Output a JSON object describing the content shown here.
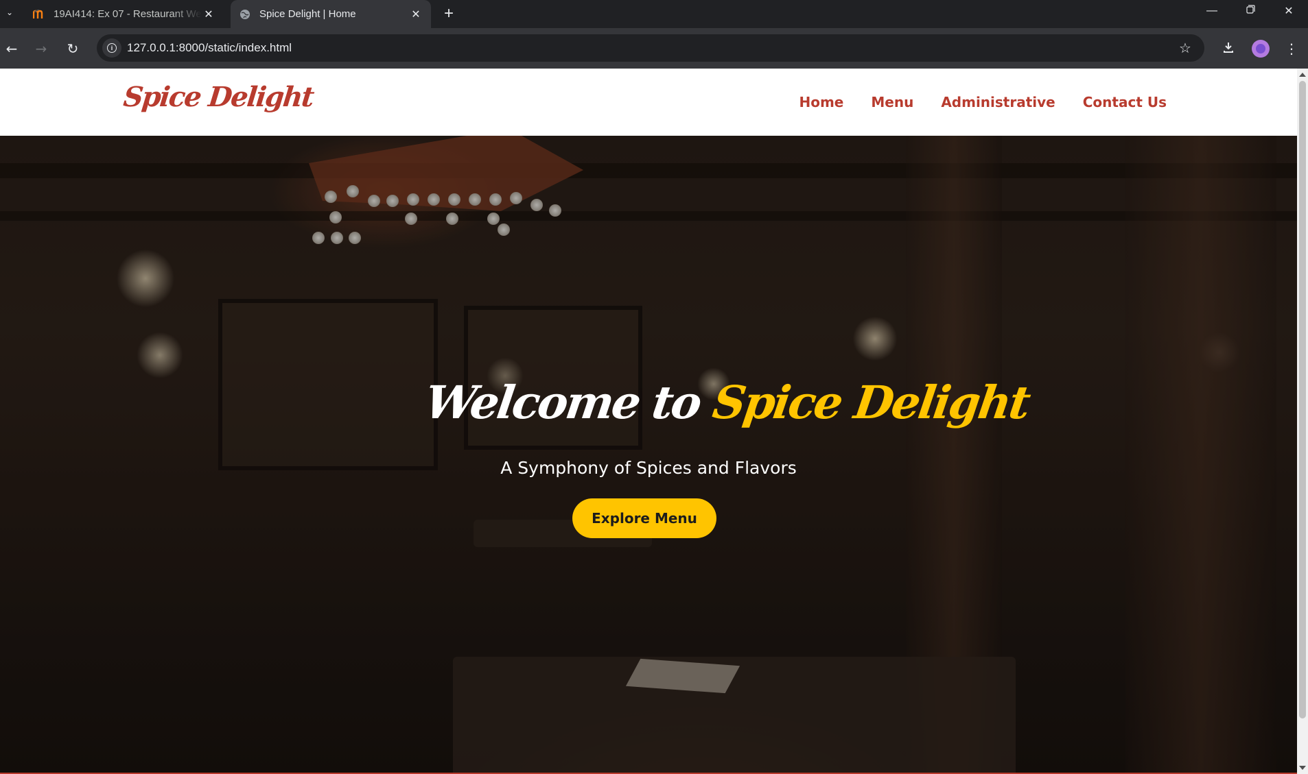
{
  "browser": {
    "tabs": [
      {
        "title": "19AI414: Ex 07 - Restaurant We",
        "favicon": "moodle-m-icon",
        "active": false
      },
      {
        "title": "Spice Delight | Home",
        "favicon": "globe-icon",
        "active": true
      }
    ],
    "url": "127.0.0.1:8000/static/index.html",
    "icons": {
      "tab_search": "chevron-down-icon",
      "new_tab": "plus-icon",
      "back": "arrow-left-icon",
      "forward": "arrow-right-icon",
      "reload": "reload-icon",
      "site_info": "info-icon",
      "bookmark": "star-icon",
      "downloads": "download-icon",
      "profile": "avatar",
      "menu": "kebab-menu-icon",
      "minimize": "minimize-icon",
      "restore": "restore-icon",
      "close": "close-icon"
    }
  },
  "site": {
    "logo": "Spice Delight",
    "nav": [
      "Home",
      "Menu",
      "Administrative",
      "Contact Us"
    ],
    "hero": {
      "title_prefix": "Welcome to",
      "title_brand": "Spice Delight",
      "subtitle": "A Symphony of Spices and Flavors",
      "cta": "Explore Menu"
    }
  },
  "colors": {
    "brand_red": "#b83b2e",
    "accent_yellow": "#ffc400",
    "chrome_dark": "#202124",
    "chrome_toolbar": "#35363a"
  }
}
